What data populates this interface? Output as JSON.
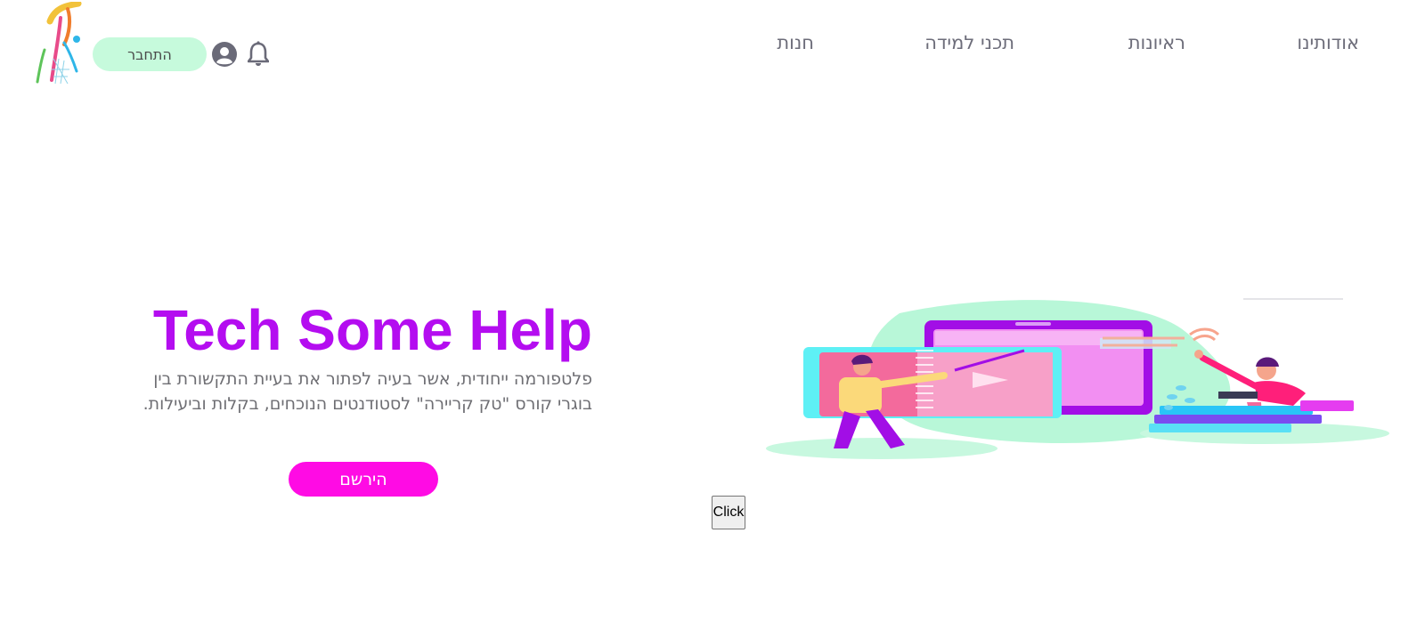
{
  "header": {
    "login_label": "התחבר",
    "icons": {
      "user": "user-circle-icon",
      "bell": "bell-icon",
      "logo": "logo-icon"
    },
    "nav": [
      {
        "label": "אודותינו"
      },
      {
        "label": "ראיונות"
      },
      {
        "label": "תכני למידה"
      },
      {
        "label": "חנות"
      }
    ]
  },
  "hero": {
    "title": "Tech Some Help",
    "description": "פלטפורמה ייחודית, אשר בעיה לפתור את בעיית התקשורת בין בוגרי קורס \"טק קריירה\" לסטודנטים הנוכחים, בקלות וביעילות.",
    "signup_label": "הירשם"
  },
  "misc": {
    "click_label": "Click"
  },
  "colors": {
    "title": "#b40df0",
    "signup_button": "#ff0be4",
    "login_button": "#c6fadc",
    "nav_text": "#6d6d7a"
  }
}
